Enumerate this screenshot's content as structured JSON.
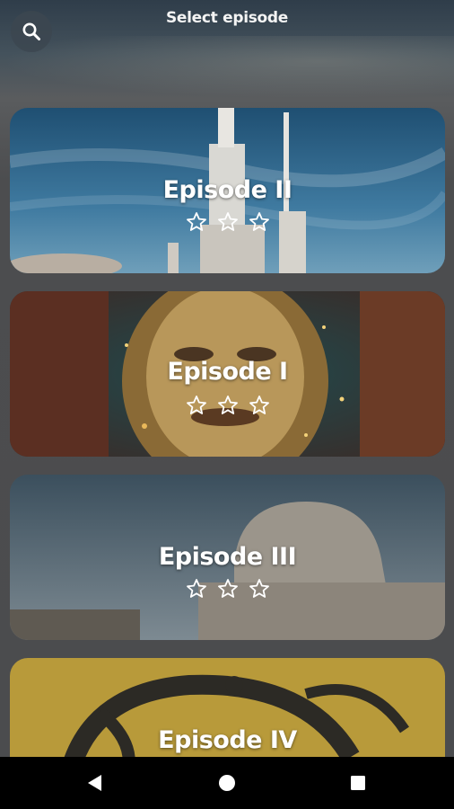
{
  "header": {
    "title": "Select episode",
    "search_icon": "search-icon"
  },
  "episodes": [
    {
      "title": "Episode II",
      "rating": 0,
      "max_rating": 3
    },
    {
      "title": "Episode I",
      "rating": 0,
      "max_rating": 3
    },
    {
      "title": "Episode III",
      "rating": 0,
      "max_rating": 3
    },
    {
      "title": "Episode IV",
      "rating": 0,
      "max_rating": 3
    }
  ],
  "navbar": {
    "back_icon": "back-triangle-icon",
    "home_icon": "home-circle-icon",
    "recents_icon": "recents-square-icon"
  },
  "colors": {
    "background": "#4b4c4e",
    "text": "#ffffff",
    "navbar": "#000000"
  }
}
